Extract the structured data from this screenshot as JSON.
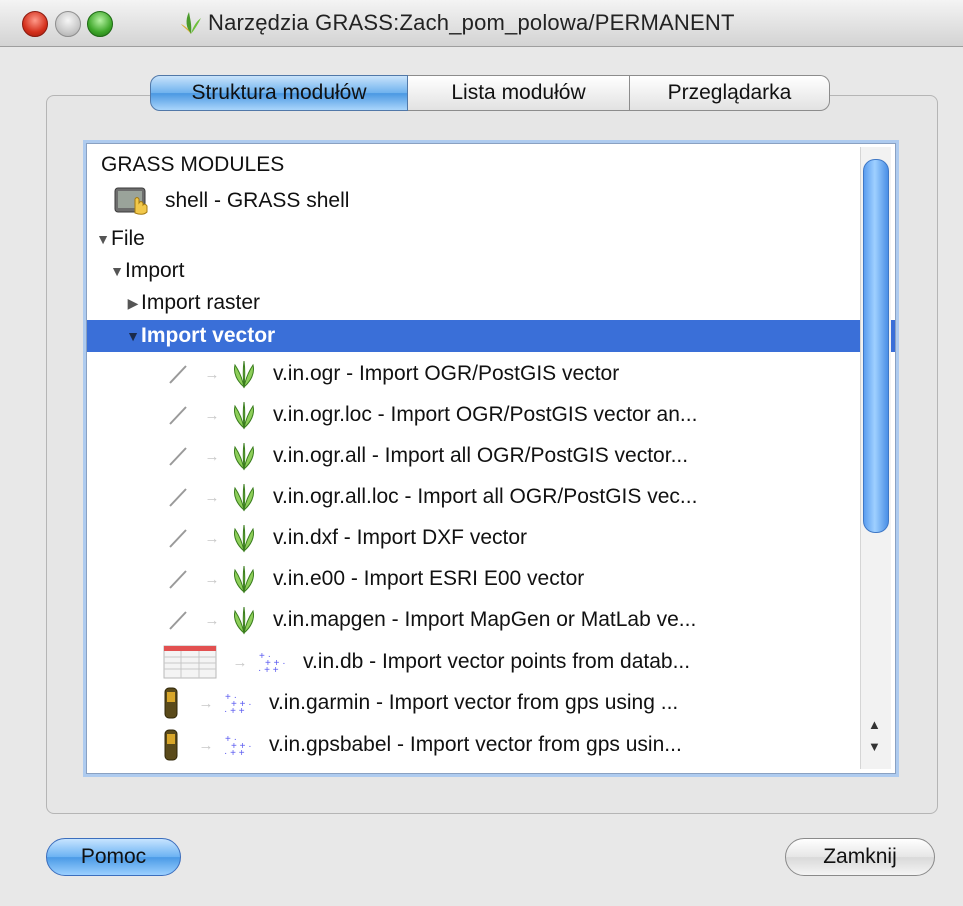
{
  "window": {
    "title": "Narzędzia GRASS:Zach_pom_polowa/PERMANENT"
  },
  "tabs": [
    {
      "label": "Struktura modułów",
      "active": true
    },
    {
      "label": "Lista modułów",
      "active": false
    },
    {
      "label": "Przeglądarka",
      "active": false
    }
  ],
  "tree": {
    "root": "GRASS MODULES",
    "shell": "shell - GRASS shell",
    "file": "File",
    "import": "Import",
    "import_raster": "Import raster",
    "import_vector": "Import vector",
    "modules": [
      {
        "label": "v.in.ogr - Import OGR/PostGIS vector",
        "icon": "vector-line-icon"
      },
      {
        "label": "v.in.ogr.loc - Import OGR/PostGIS vector an...",
        "icon": "vector-line-icon"
      },
      {
        "label": "v.in.ogr.all - Import all OGR/PostGIS vector...",
        "icon": "vector-line-icon"
      },
      {
        "label": "v.in.ogr.all.loc - Import all OGR/PostGIS vec...",
        "icon": "vector-line-icon"
      },
      {
        "label": "v.in.dxf - Import DXF vector",
        "icon": "vector-line-icon"
      },
      {
        "label": "v.in.e00 - Import ESRI E00 vector",
        "icon": "vector-line-icon"
      },
      {
        "label": "v.in.mapgen - Import MapGen or MatLab ve...",
        "icon": "vector-line-icon"
      },
      {
        "label": "v.in.db - Import vector points from datab...",
        "icon": "table-icon"
      },
      {
        "label": "v.in.garmin - Import vector from gps using ...",
        "icon": "gps-icon"
      },
      {
        "label": "v.in.gpsbabel - Import vector from gps usin...",
        "icon": "gps-icon"
      }
    ]
  },
  "buttons": {
    "help": "Pomoc",
    "close": "Zamknij"
  },
  "colors": {
    "selection": "#3a6fd8",
    "accent": "#4a98e2"
  }
}
